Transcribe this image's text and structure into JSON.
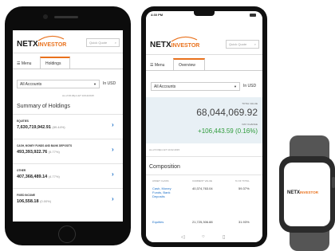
{
  "brand": {
    "logo_main": "NETX",
    "logo_sub": "INVESTOR",
    "accent": "#e9711c",
    "link": "#1b6fc7",
    "positive": "#2e9b3a"
  },
  "phone_left": {
    "quick_quote": "Quick Quote",
    "menu_label": "Menu",
    "tab_label": "Holdings",
    "account_select": "All Accounts",
    "currency": "In USD",
    "as_of": "As of 06:29pm ET 10/12/2015",
    "section_title": "Summary of Holdings",
    "rows": [
      {
        "label": "EQUITIES",
        "value": "7,630,719,942.91",
        "pct": "(89.44%)"
      },
      {
        "label": "CASH, MONEY FUNDS AND BANK DEPOSITS",
        "value": "493,393,922.76",
        "pct": "(5.77%)"
      },
      {
        "label": "OTHER",
        "value": "407,368,489.14",
        "pct": "(4.77%)"
      },
      {
        "label": "FIXED INCOME",
        "value": "106,558.18",
        "pct": "(0.00%)"
      }
    ]
  },
  "phone_right": {
    "status_time": "4:30 PM",
    "quick_quote": "Quick Quote",
    "menu_label": "Menu",
    "tab_label": "Overview",
    "account_select": "All Accounts",
    "currency": "In USD",
    "total_value_label": "TOTAL VALUE",
    "total_value": "68,044,069.92",
    "day_change_label": "DAY CHANGE",
    "day_change": "+106,443.59 (0.16%)",
    "as_of": "As of 6:00pm ET 10.02.2015",
    "composition_title": "Composition",
    "columns": [
      "ASSET CLASS",
      "CURRENT VALUE",
      "% OF TOTAL"
    ],
    "rows": [
      {
        "asset": "Cash, Money Funds, Bank Deposits",
        "value": "40,374,763.04",
        "pct": "59.37%"
      },
      {
        "asset": "Equities",
        "value": "21,725,306.88",
        "pct": "31.93%"
      }
    ]
  },
  "watch": {
    "logo_main": "NETX",
    "logo_sub": "INVESTOR"
  }
}
